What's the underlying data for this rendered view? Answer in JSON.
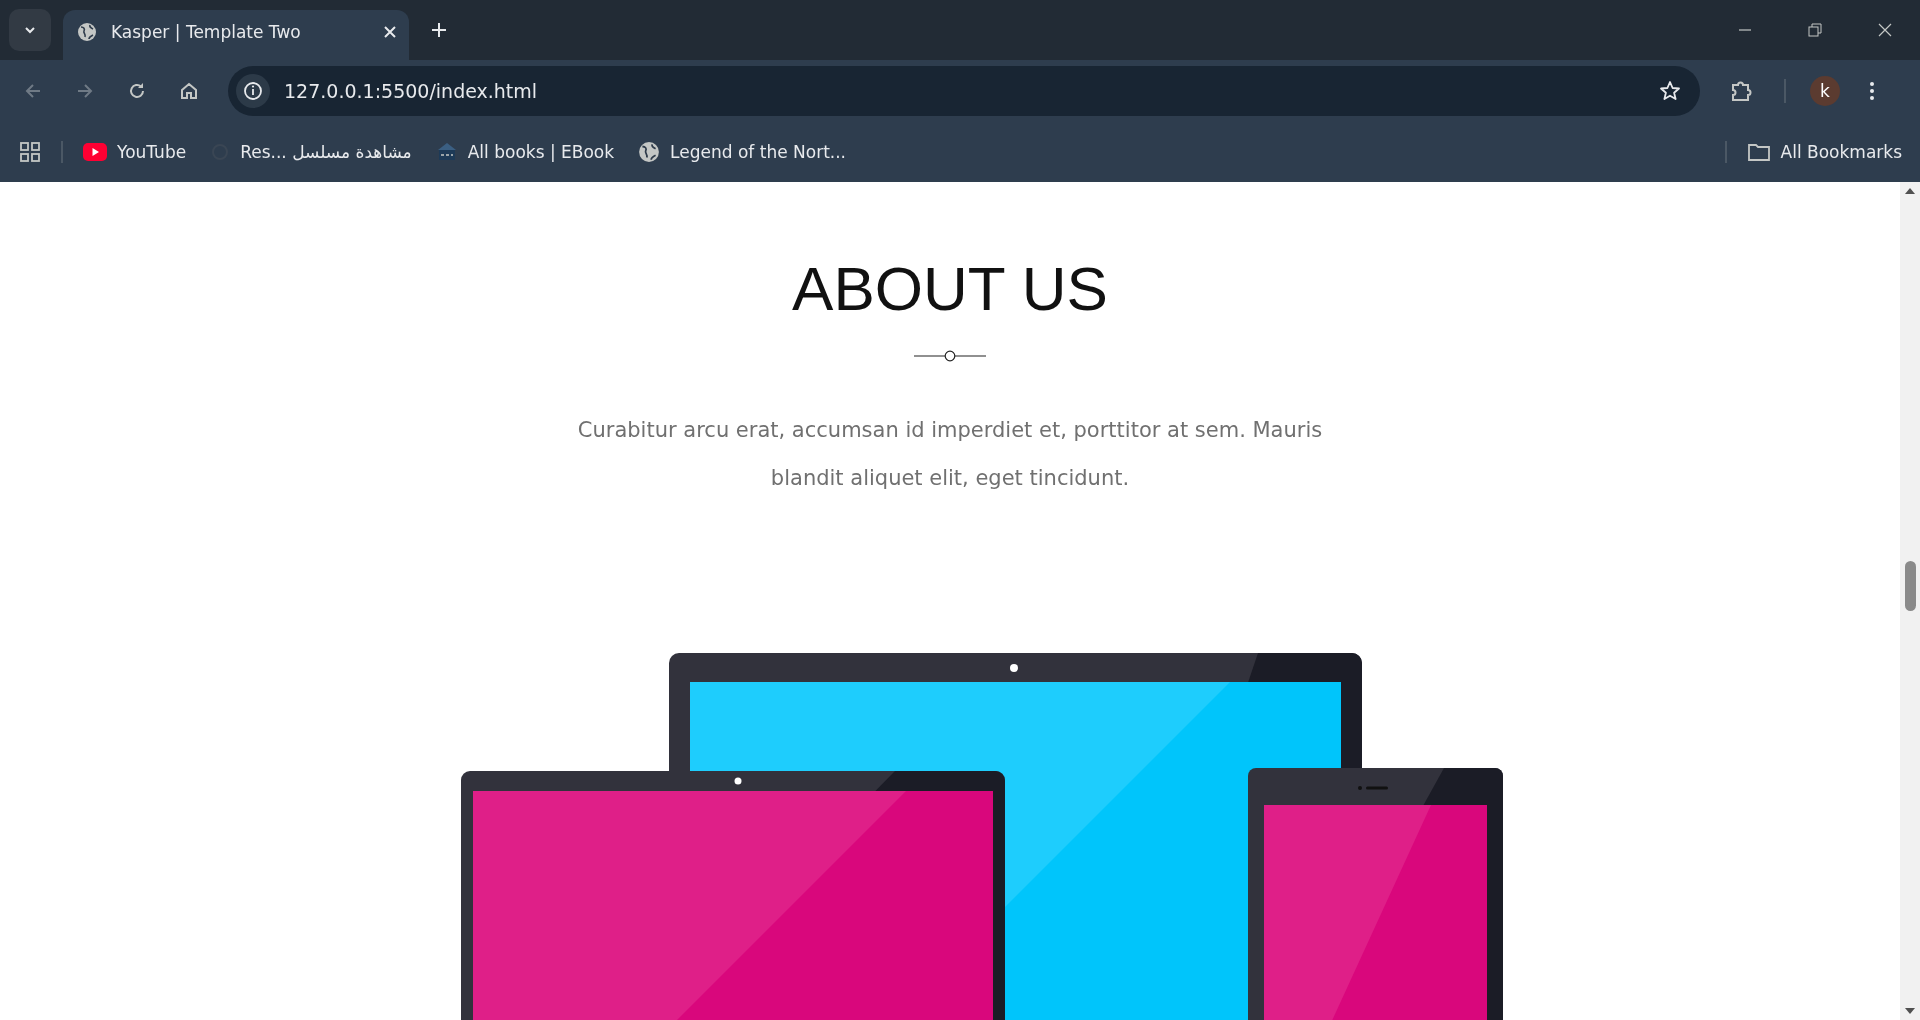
{
  "browser": {
    "tabs": [
      {
        "title": "Kasper | Template Two",
        "selected": true
      }
    ],
    "address": "127.0.0.1:5500/index.html",
    "profile_initial": "k",
    "bookmarks": [
      {
        "label": "YouTube",
        "kind": "youtube"
      },
      {
        "label": "Res... مشاهدة مسلسل",
        "kind": "faded"
      },
      {
        "label": "All books | EBook",
        "kind": "book"
      },
      {
        "label": "Legend of the Nort...",
        "kind": "globe"
      }
    ],
    "all_bookmarks": "All Bookmarks"
  },
  "page": {
    "heading": "ABOUT US",
    "text": "Curabitur arcu erat, accumsan id imperdiet et, porttitor at sem. Mauris blandit aliquet elit, eget tincidunt."
  }
}
